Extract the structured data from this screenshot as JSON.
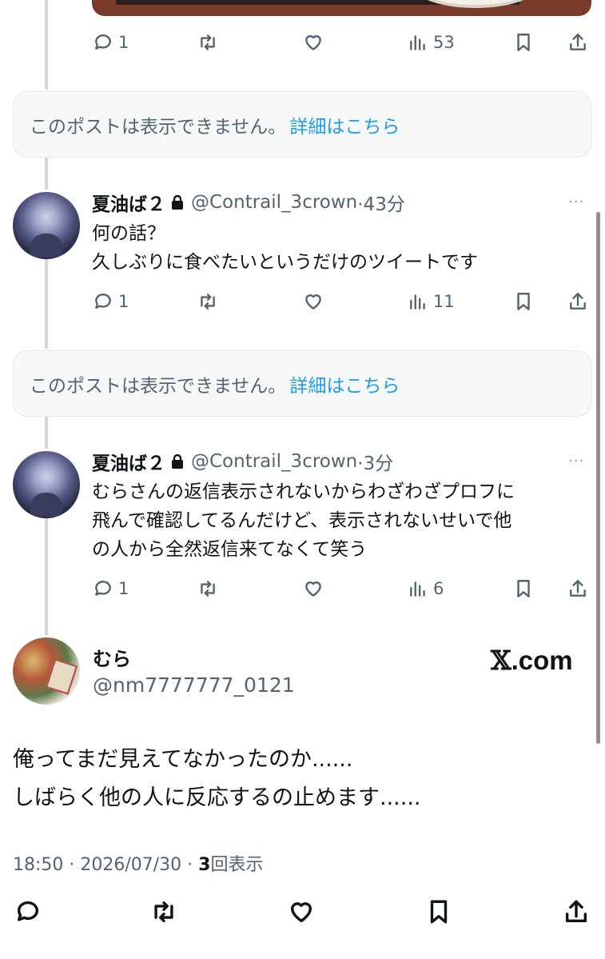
{
  "top_post": {
    "actions": {
      "replies": "1",
      "views": "53"
    }
  },
  "unavailable_1": {
    "text": "このポストは表示できません。",
    "link": "詳細はこちら"
  },
  "reply_1": {
    "name": "夏油ば２",
    "handle": "@Contrail_3crown",
    "time": "·43分",
    "more": "···",
    "line1": "何の話？",
    "line2": "久しぶりに食べたいというだけのツイートです",
    "actions": {
      "replies": "1",
      "views": "11"
    }
  },
  "unavailable_2": {
    "text": "このポストは表示できません。",
    "link": "詳細はこちら"
  },
  "reply_2": {
    "name": "夏油ば２",
    "handle": "@Contrail_3crown",
    "time": "·3分",
    "more": "···",
    "line1": "むらさんの返信表示されないからわざわざプロフに",
    "line2": "飛んで確認してるんだけど、表示されないせいで他",
    "line3": "の人から全然返信来てなくて笑う",
    "actions": {
      "replies": "1",
      "views": "6"
    }
  },
  "main_post": {
    "name": "むら",
    "handle": "@nm7777777_0121",
    "watermark_x": "𝕏",
    "watermark_domain": ".com",
    "line1": "俺ってまだ見えてなかったのか......",
    "line2": "しばらく他の人に反応するの止めます......",
    "timestamp": "18:50 · 2026/07/30 · ",
    "view_count": "3",
    "view_label": "回表示"
  },
  "icons": [
    "reply-icon",
    "retweet-icon",
    "like-icon",
    "views-icon",
    "bookmark-icon",
    "share-icon",
    "lock-icon"
  ],
  "colors": {
    "link": "#1d9bf0",
    "muted": "#536471",
    "text": "#0f1419"
  }
}
